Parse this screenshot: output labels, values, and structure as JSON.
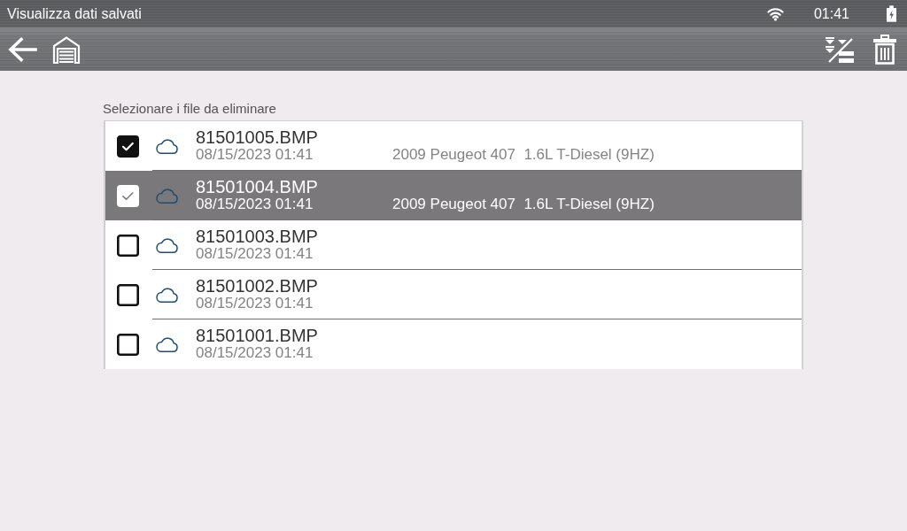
{
  "status_bar": {
    "title": "Visualizza dati salvati",
    "time": "01:41"
  },
  "instruction": "Selezionare i file da eliminare",
  "files": [
    {
      "name": "81501005.BMP",
      "date": "08/15/2023 01:41",
      "vehicle": "2009 Peugeot 407  1.6L T-Diesel (9HZ)",
      "checked": true,
      "selected": false
    },
    {
      "name": "81501004.BMP",
      "date": "08/15/2023 01:41",
      "vehicle": "2009 Peugeot 407  1.6L T-Diesel (9HZ)",
      "checked": true,
      "selected": true
    },
    {
      "name": "81501003.BMP",
      "date": "08/15/2023 01:41",
      "checked": false,
      "selected": false
    },
    {
      "name": "81501002.BMP",
      "date": "08/15/2023 01:41",
      "checked": false,
      "selected": false
    },
    {
      "name": "81501001.BMP",
      "date": "08/15/2023 01:41",
      "checked": false,
      "selected": false
    }
  ]
}
